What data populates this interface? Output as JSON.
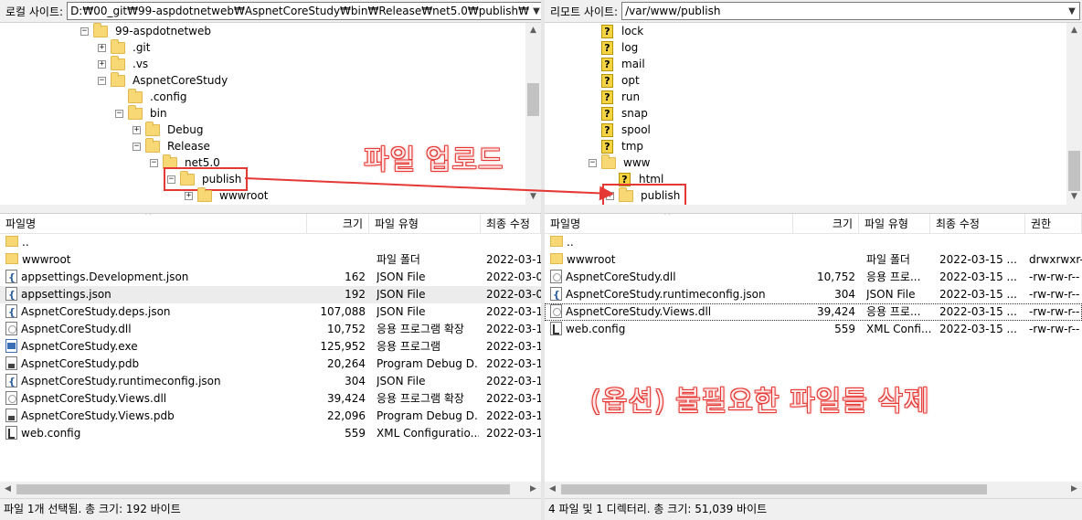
{
  "local": {
    "site_label": "로컬 사이트:",
    "path": "D:₩00_git₩99-aspdotnetweb₩AspnetCoreStudy₩bin₩Release₩net5.0₩publish₩",
    "tree": [
      {
        "name": "99-aspdotnetweb",
        "exp": "−",
        "depth": 0
      },
      {
        "name": ".git",
        "exp": "+",
        "depth": 1
      },
      {
        "name": ".vs",
        "exp": "+",
        "depth": 1
      },
      {
        "name": "AspnetCoreStudy",
        "exp": "−",
        "depth": 1
      },
      {
        "name": ".config",
        "exp": "",
        "depth": 2
      },
      {
        "name": "bin",
        "exp": "−",
        "depth": 2
      },
      {
        "name": "Debug",
        "exp": "+",
        "depth": 3
      },
      {
        "name": "Release",
        "exp": "−",
        "depth": 3
      },
      {
        "name": "net5.0",
        "exp": "−",
        "depth": 4
      },
      {
        "name": "publish",
        "exp": "−",
        "depth": 5,
        "highlight": true
      },
      {
        "name": "wwwroot",
        "exp": "+",
        "depth": 6
      }
    ],
    "columns": {
      "name": "파일명",
      "size": "크기",
      "type": "파일 유형",
      "modified": "최종 수정"
    },
    "files": [
      {
        "name": "..",
        "size": "",
        "type": "",
        "modified": "",
        "icon": "folder"
      },
      {
        "name": "wwwroot",
        "size": "",
        "type": "파일 폴더",
        "modified": "2022-03-1",
        "icon": "folder"
      },
      {
        "name": "appsettings.Development.json",
        "size": "162",
        "type": "JSON File",
        "modified": "2022-03-0",
        "icon": "json"
      },
      {
        "name": "appsettings.json",
        "size": "192",
        "type": "JSON File",
        "modified": "2022-03-0",
        "icon": "json",
        "selected": true
      },
      {
        "name": "AspnetCoreStudy.deps.json",
        "size": "107,088",
        "type": "JSON File",
        "modified": "2022-03-1",
        "icon": "json"
      },
      {
        "name": "AspnetCoreStudy.dll",
        "size": "10,752",
        "type": "응용 프로그램 확장",
        "modified": "2022-03-1",
        "icon": "dll"
      },
      {
        "name": "AspnetCoreStudy.exe",
        "size": "125,952",
        "type": "응용 프로그램",
        "modified": "2022-03-1",
        "icon": "exe"
      },
      {
        "name": "AspnetCoreStudy.pdb",
        "size": "20,264",
        "type": "Program Debug D...",
        "modified": "2022-03-1",
        "icon": "pdb"
      },
      {
        "name": "AspnetCoreStudy.runtimeconfig.json",
        "size": "304",
        "type": "JSON File",
        "modified": "2022-03-1",
        "icon": "json"
      },
      {
        "name": "AspnetCoreStudy.Views.dll",
        "size": "39,424",
        "type": "응용 프로그램 확장",
        "modified": "2022-03-1",
        "icon": "dll"
      },
      {
        "name": "AspnetCoreStudy.Views.pdb",
        "size": "22,096",
        "type": "Program Debug D...",
        "modified": "2022-03-1",
        "icon": "pdb"
      },
      {
        "name": "web.config",
        "size": "559",
        "type": "XML Configuratio...",
        "modified": "2022-03-1",
        "icon": "cfg"
      }
    ],
    "status": "파일 1개 선택됨. 총 크기: 192 바이트"
  },
  "remote": {
    "site_label": "리모트 사이트:",
    "path": "/var/www/publish",
    "tree": [
      {
        "name": "lock",
        "exp": "",
        "depth": 0,
        "icon": "unknown"
      },
      {
        "name": "log",
        "exp": "",
        "depth": 0,
        "icon": "unknown"
      },
      {
        "name": "mail",
        "exp": "",
        "depth": 0,
        "icon": "unknown"
      },
      {
        "name": "opt",
        "exp": "",
        "depth": 0,
        "icon": "unknown"
      },
      {
        "name": "run",
        "exp": "",
        "depth": 0,
        "icon": "unknown"
      },
      {
        "name": "snap",
        "exp": "",
        "depth": 0,
        "icon": "unknown"
      },
      {
        "name": "spool",
        "exp": "",
        "depth": 0,
        "icon": "unknown"
      },
      {
        "name": "tmp",
        "exp": "",
        "depth": 0,
        "icon": "unknown"
      },
      {
        "name": "www",
        "exp": "−",
        "depth": 0,
        "icon": "folder"
      },
      {
        "name": "html",
        "exp": "",
        "depth": 1,
        "icon": "unknown"
      },
      {
        "name": "publish",
        "exp": "+",
        "depth": 1,
        "icon": "folder",
        "highlight": true
      }
    ],
    "columns": {
      "name": "파일명",
      "size": "크기",
      "type": "파일 유형",
      "modified": "최종 수정",
      "perm": "권한"
    },
    "files": [
      {
        "name": "..",
        "size": "",
        "type": "",
        "modified": "",
        "perm": "",
        "icon": "folder"
      },
      {
        "name": "wwwroot",
        "size": "",
        "type": "파일 폴더",
        "modified": "2022-03-15 ...",
        "perm": "drwxrwxr-",
        "icon": "folder"
      },
      {
        "name": "AspnetCoreStudy.dll",
        "size": "10,752",
        "type": "응용 프로...",
        "modified": "2022-03-15 ...",
        "perm": "-rw-rw-r--",
        "icon": "dll"
      },
      {
        "name": "AspnetCoreStudy.runtimeconfig.json",
        "size": "304",
        "type": "JSON File",
        "modified": "2022-03-15 ...",
        "perm": "-rw-rw-r--",
        "icon": "json"
      },
      {
        "name": "AspnetCoreStudy.Views.dll",
        "size": "39,424",
        "type": "응용 프로...",
        "modified": "2022-03-15 ...",
        "perm": "-rw-rw-r--",
        "icon": "dll",
        "focus": true
      },
      {
        "name": "web.config",
        "size": "559",
        "type": "XML Confi...",
        "modified": "2022-03-15 ...",
        "perm": "-rw-rw-r--",
        "icon": "cfg"
      }
    ],
    "status": "4 파일 및 1 디렉터리. 총 크기: 51,039 바이트"
  },
  "annotations": {
    "upload": "파일 업로드",
    "delete": "(옵션) 불필요한 파일들 삭제",
    "color": "#e53935"
  }
}
